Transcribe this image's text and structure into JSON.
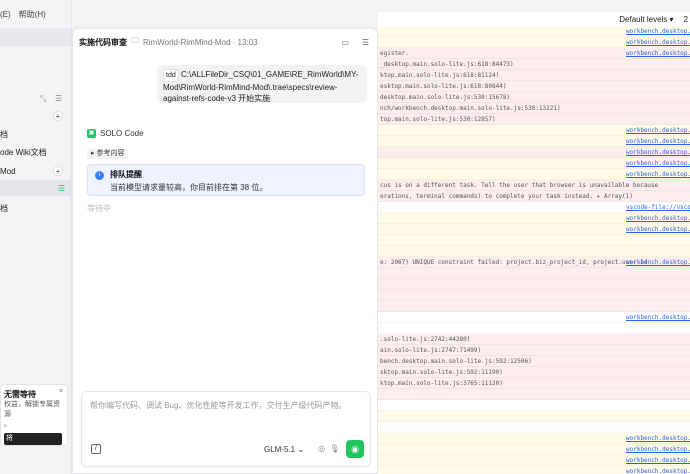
{
  "menu": {
    "items": [
      "(E)",
      "帮助(H)"
    ]
  },
  "sidebar": {
    "rows": [
      "档",
      "ode Wiki文档",
      "Mod",
      "",
      "档"
    ],
    "promo": {
      "title": "无需等待",
      "desc1": "权益，解锁专属资源",
      "desc2": "。",
      "button": "将"
    }
  },
  "chat": {
    "title": "实施代码审查",
    "breadcrumb": "RimWorld-RimMind-Mod · 13:03",
    "message": {
      "chip": "tdd",
      "text": "C:\\ALLFileDir_CSQ\\01_GAME\\RE_RimWorld\\MY-Mod\\RimWorld-RimMind-Mod\\.trae\\specs\\review-against-refs-code-v3 开始实施"
    },
    "agent_name": "SOLO Code",
    "ref_label": "参考内容",
    "notice": {
      "title": "排队提醒",
      "body": "当前模型请求量较高，你目前排在第 38 位。"
    },
    "waiting": "等待中",
    "input_placeholder": "帮你编写代码、调试 Bug、优化性能等开发工作，交付生产级代码产物。",
    "model": "GLM-5.1"
  },
  "log": {
    "filter": "Default levels ▾",
    "count": "2",
    "rows": [
      {
        "t": "",
        "s": "workbench.desktop.mai",
        "k": "w"
      },
      {
        "t": "",
        "s": "workbench.desktop.mai",
        "k": "w"
      },
      {
        "t": "egister.",
        "s": "workbench.desktop.mai",
        "k": "e"
      },
      {
        "t": "_desktop.main.solo-lite.js:618:84473)",
        "s": "",
        "k": "e"
      },
      {
        "t": "ktop.main.solo-lite.js:618:81124)",
        "s": "",
        "k": "e"
      },
      {
        "t": "esktop.main.solo-lite.js:618:80844)",
        "s": "",
        "k": "e"
      },
      {
        "t": "desktop.main.solo-lite.js:530:15678)",
        "s": "",
        "k": "e"
      },
      {
        "t": "nch/workbench.desktop.main.solo-lite.js:530:13221)",
        "s": "",
        "k": "e"
      },
      {
        "t": "top.main.solo-lite.js:530:12857)",
        "s": "",
        "k": "e"
      },
      {
        "t": "",
        "s": "workbench.desktop.mai",
        "k": "w"
      },
      {
        "t": "",
        "s": "workbench.desktop.mai",
        "k": "w"
      },
      {
        "t": "",
        "s": "workbench.desktop.mai",
        "k": "e"
      },
      {
        "t": "",
        "s": "workbench.desktop.mai",
        "k": "w"
      },
      {
        "t": "",
        "s": "workbench.desktop.mai",
        "k": "w"
      },
      {
        "t": "cus is on a different task. Tell the user that browser is unavailable because",
        "s": "",
        "k": "e"
      },
      {
        "t": "erations, terminal commands) to complete your task instead.   ▸ Array(1)",
        "s": "",
        "k": "e"
      },
      {
        "t": "",
        "s": "vscode-file://vscode-",
        "k": "n"
      },
      {
        "t": "",
        "s": "workbench.desktop.mai",
        "k": "w"
      },
      {
        "t": "",
        "s": "workbench.desktop.mai",
        "k": "w"
      },
      {
        "t": "",
        "s": "",
        "k": "w"
      },
      {
        "t": "",
        "s": "",
        "k": "w"
      },
      {
        "t": "e: 2067) UNIQUE constraint failed: project.biz_project_id, project.user_id",
        "s": "workbench.desktop.mai",
        "k": "e"
      },
      {
        "t": "",
        "s": "",
        "k": "e"
      },
      {
        "t": "",
        "s": "",
        "k": "e"
      },
      {
        "t": "",
        "s": "",
        "k": "e"
      },
      {
        "t": "",
        "s": "",
        "k": "e"
      },
      {
        "t": "",
        "s": "workbench.desktop.mai",
        "k": "n"
      },
      {
        "t": "",
        "s": "",
        "k": "n"
      },
      {
        "t": ".solo-lite.js:2742:44280)",
        "s": "",
        "k": "e"
      },
      {
        "t": "ain.solo-lite.js:2747:71499)",
        "s": "",
        "k": "e"
      },
      {
        "t": "bench.desktop.main.solo-lite.js:592:12506)",
        "s": "",
        "k": "e"
      },
      {
        "t": "sktop.main.solo-lite.js:592:11190)",
        "s": "",
        "k": "e"
      },
      {
        "t": "ktop.main.solo-lite.js:3765:11120)",
        "s": "",
        "k": "e"
      },
      {
        "t": "",
        "s": "",
        "k": "e"
      },
      {
        "t": "",
        "s": "",
        "k": "n"
      },
      {
        "t": "",
        "s": "",
        "k": "w"
      },
      {
        "t": "",
        "s": "",
        "k": "n"
      },
      {
        "t": "",
        "s": "workbench.desktop.mai",
        "k": "w"
      },
      {
        "t": "",
        "s": "workbench.desktop.mai",
        "k": "w"
      },
      {
        "t": "",
        "s": "workbench.desktop.mai",
        "k": "w"
      },
      {
        "t": "",
        "s": "workbench.desktop.mai",
        "k": "w"
      },
      {
        "t": "",
        "s": "workbench.desktop.mai",
        "k": "w"
      }
    ]
  }
}
